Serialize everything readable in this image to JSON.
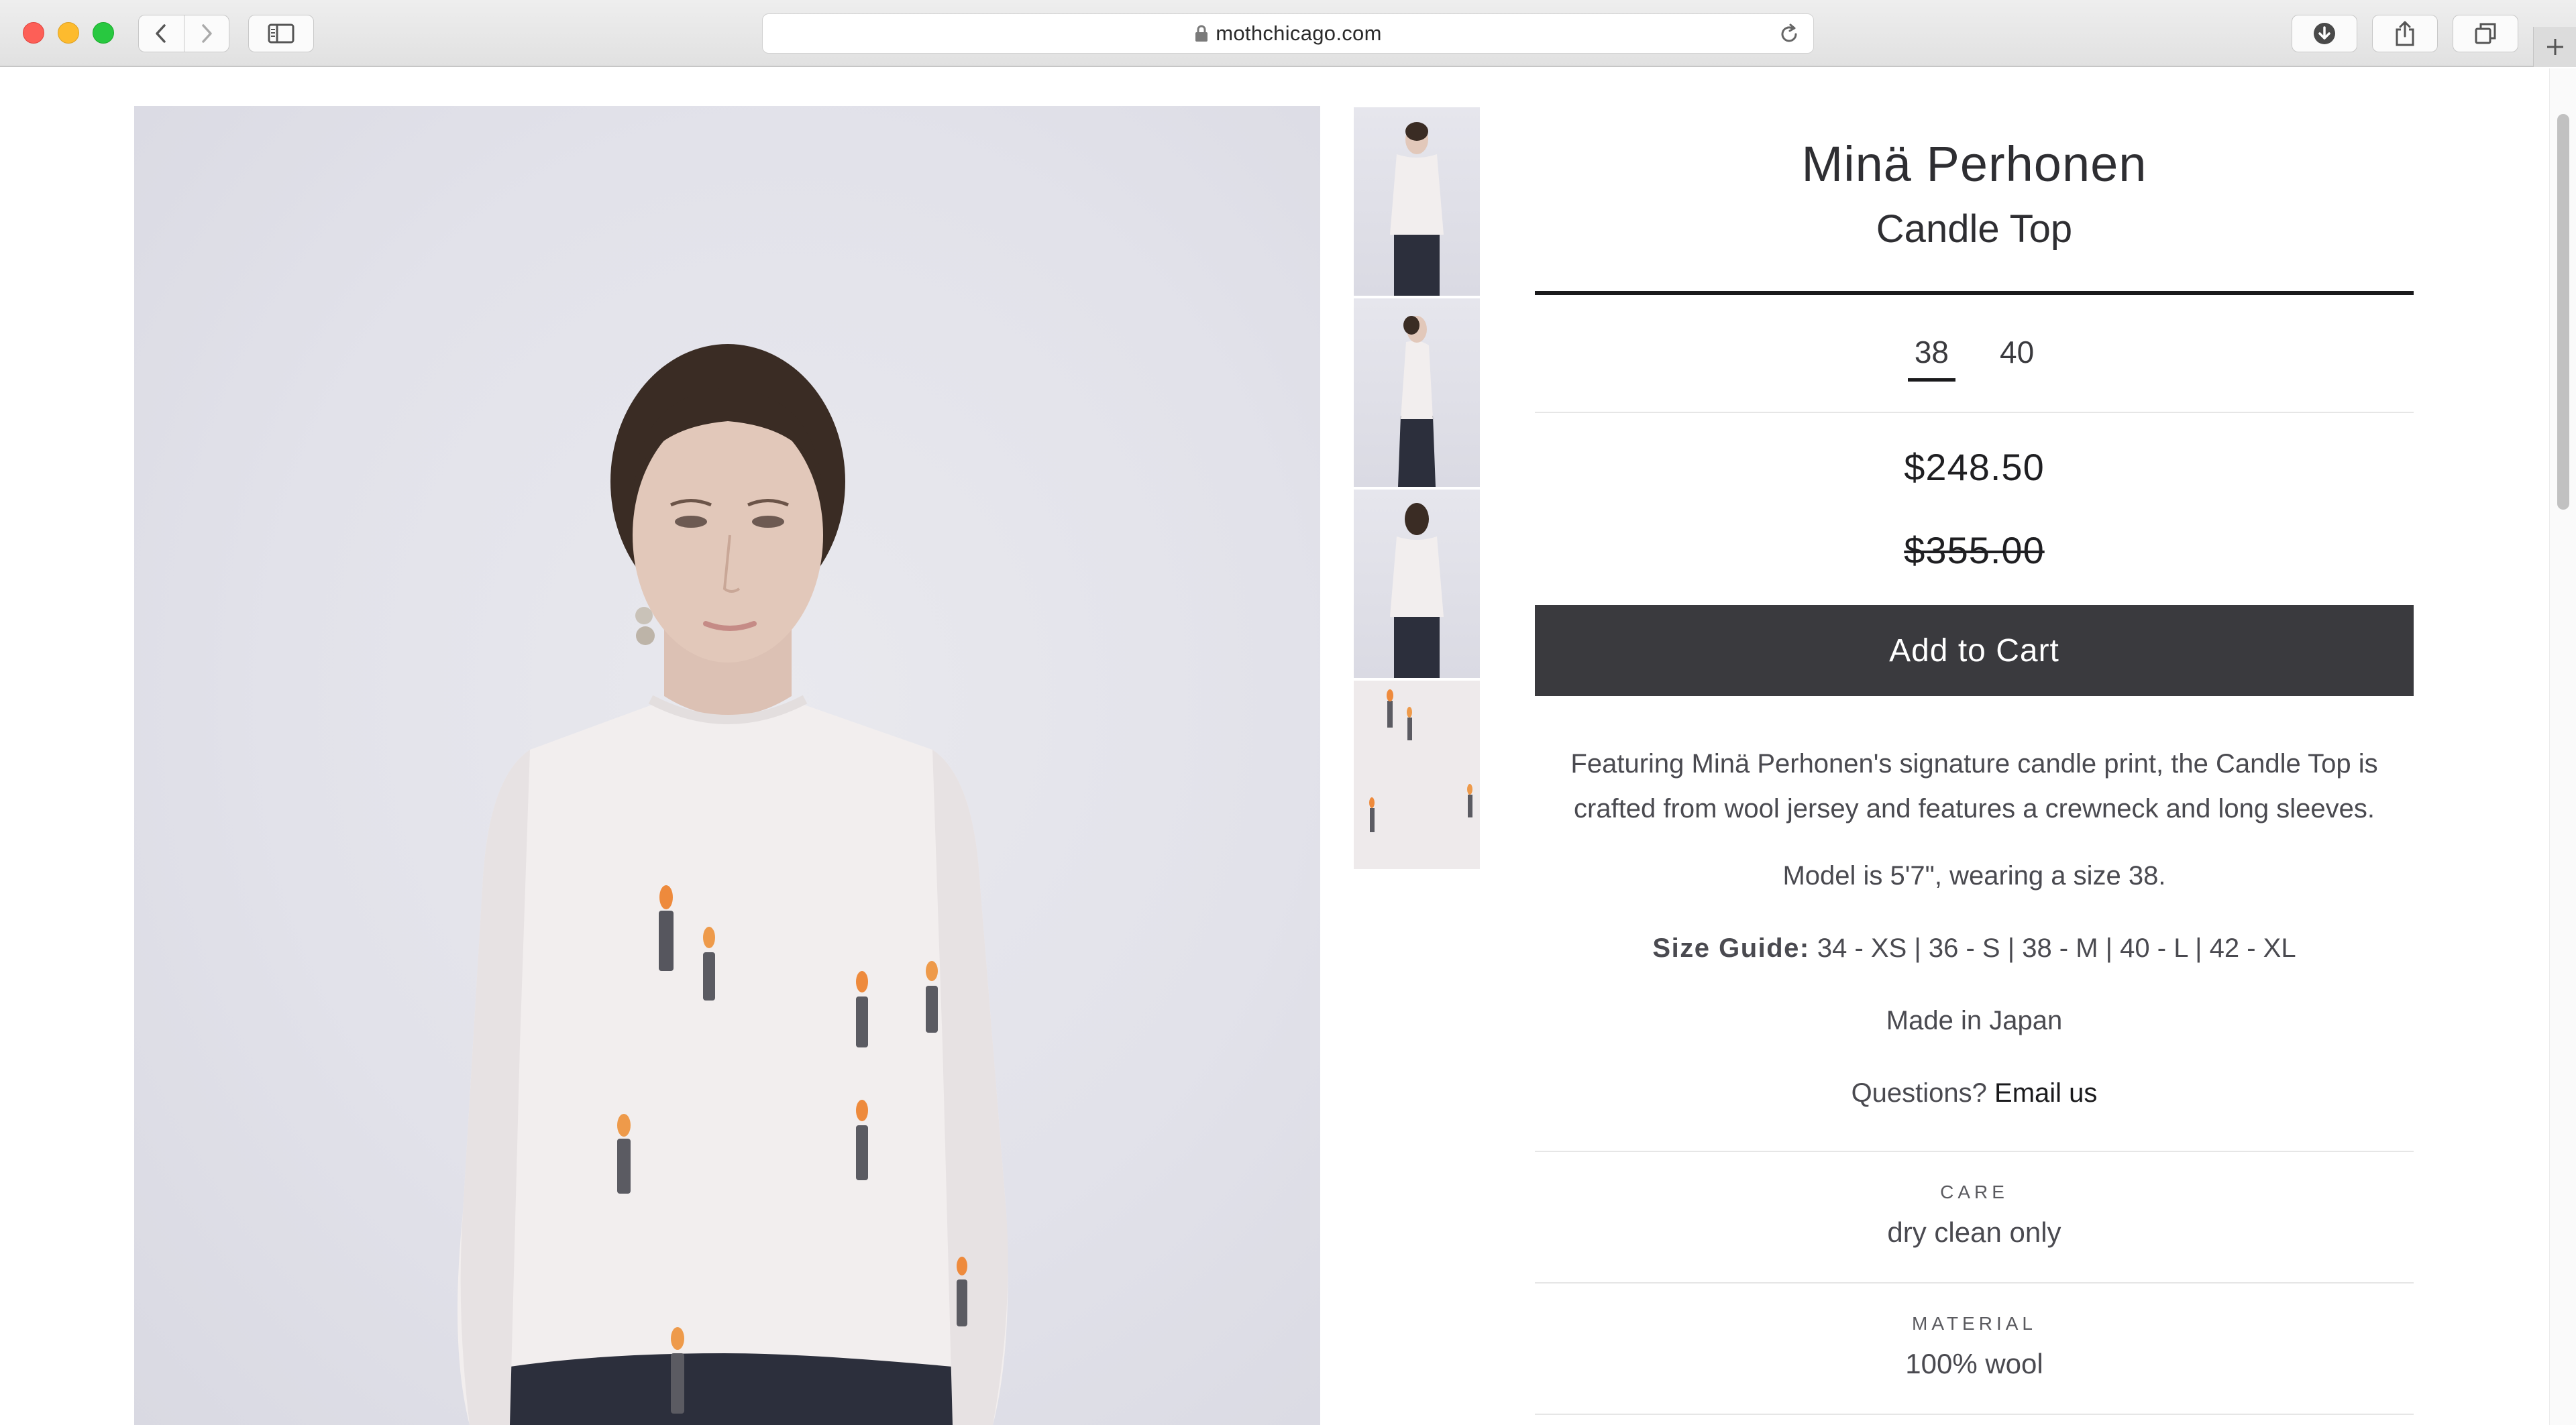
{
  "browser": {
    "url": "mothchicago.com"
  },
  "product": {
    "brand": "Minä Perhonen",
    "name": "Candle Top",
    "sizes": [
      {
        "label": "38",
        "selected": true
      },
      {
        "label": "40",
        "selected": false
      }
    ],
    "price": "$248.50",
    "original_price": "$355.00",
    "add_to_cart_label": "Add to Cart",
    "description": "Featuring Minä Perhonen's signature candle print, the Candle Top is crafted from wool jersey and features a crewneck and long sleeves.",
    "model_note": "Model is 5'7\", wearing a size 38.",
    "size_guide_label": "Size Guide:",
    "size_guide_value": " 34 - XS | 36 - S | 38 - M | 40 - L | 42 - XL",
    "made_in": "Made in Japan",
    "questions_label": "Questions? ",
    "email_link": "Email us",
    "specs": [
      {
        "label": "CARE",
        "value": "dry clean only"
      },
      {
        "label": "MATERIAL",
        "value": "100% wool"
      }
    ]
  },
  "icons": {
    "back": "chevron-left-icon",
    "forward": "chevron-right-icon",
    "sidebar": "sidebar-icon",
    "lock": "lock-icon",
    "reload": "reload-icon",
    "download": "download-icon",
    "share": "share-icon",
    "tabs": "tabs-icon",
    "new_tab": "plus-icon"
  },
  "colors": {
    "button_bg": "#3a3a3e",
    "text": "#3a3a3e",
    "photo_bg": "#e2e2ea"
  }
}
